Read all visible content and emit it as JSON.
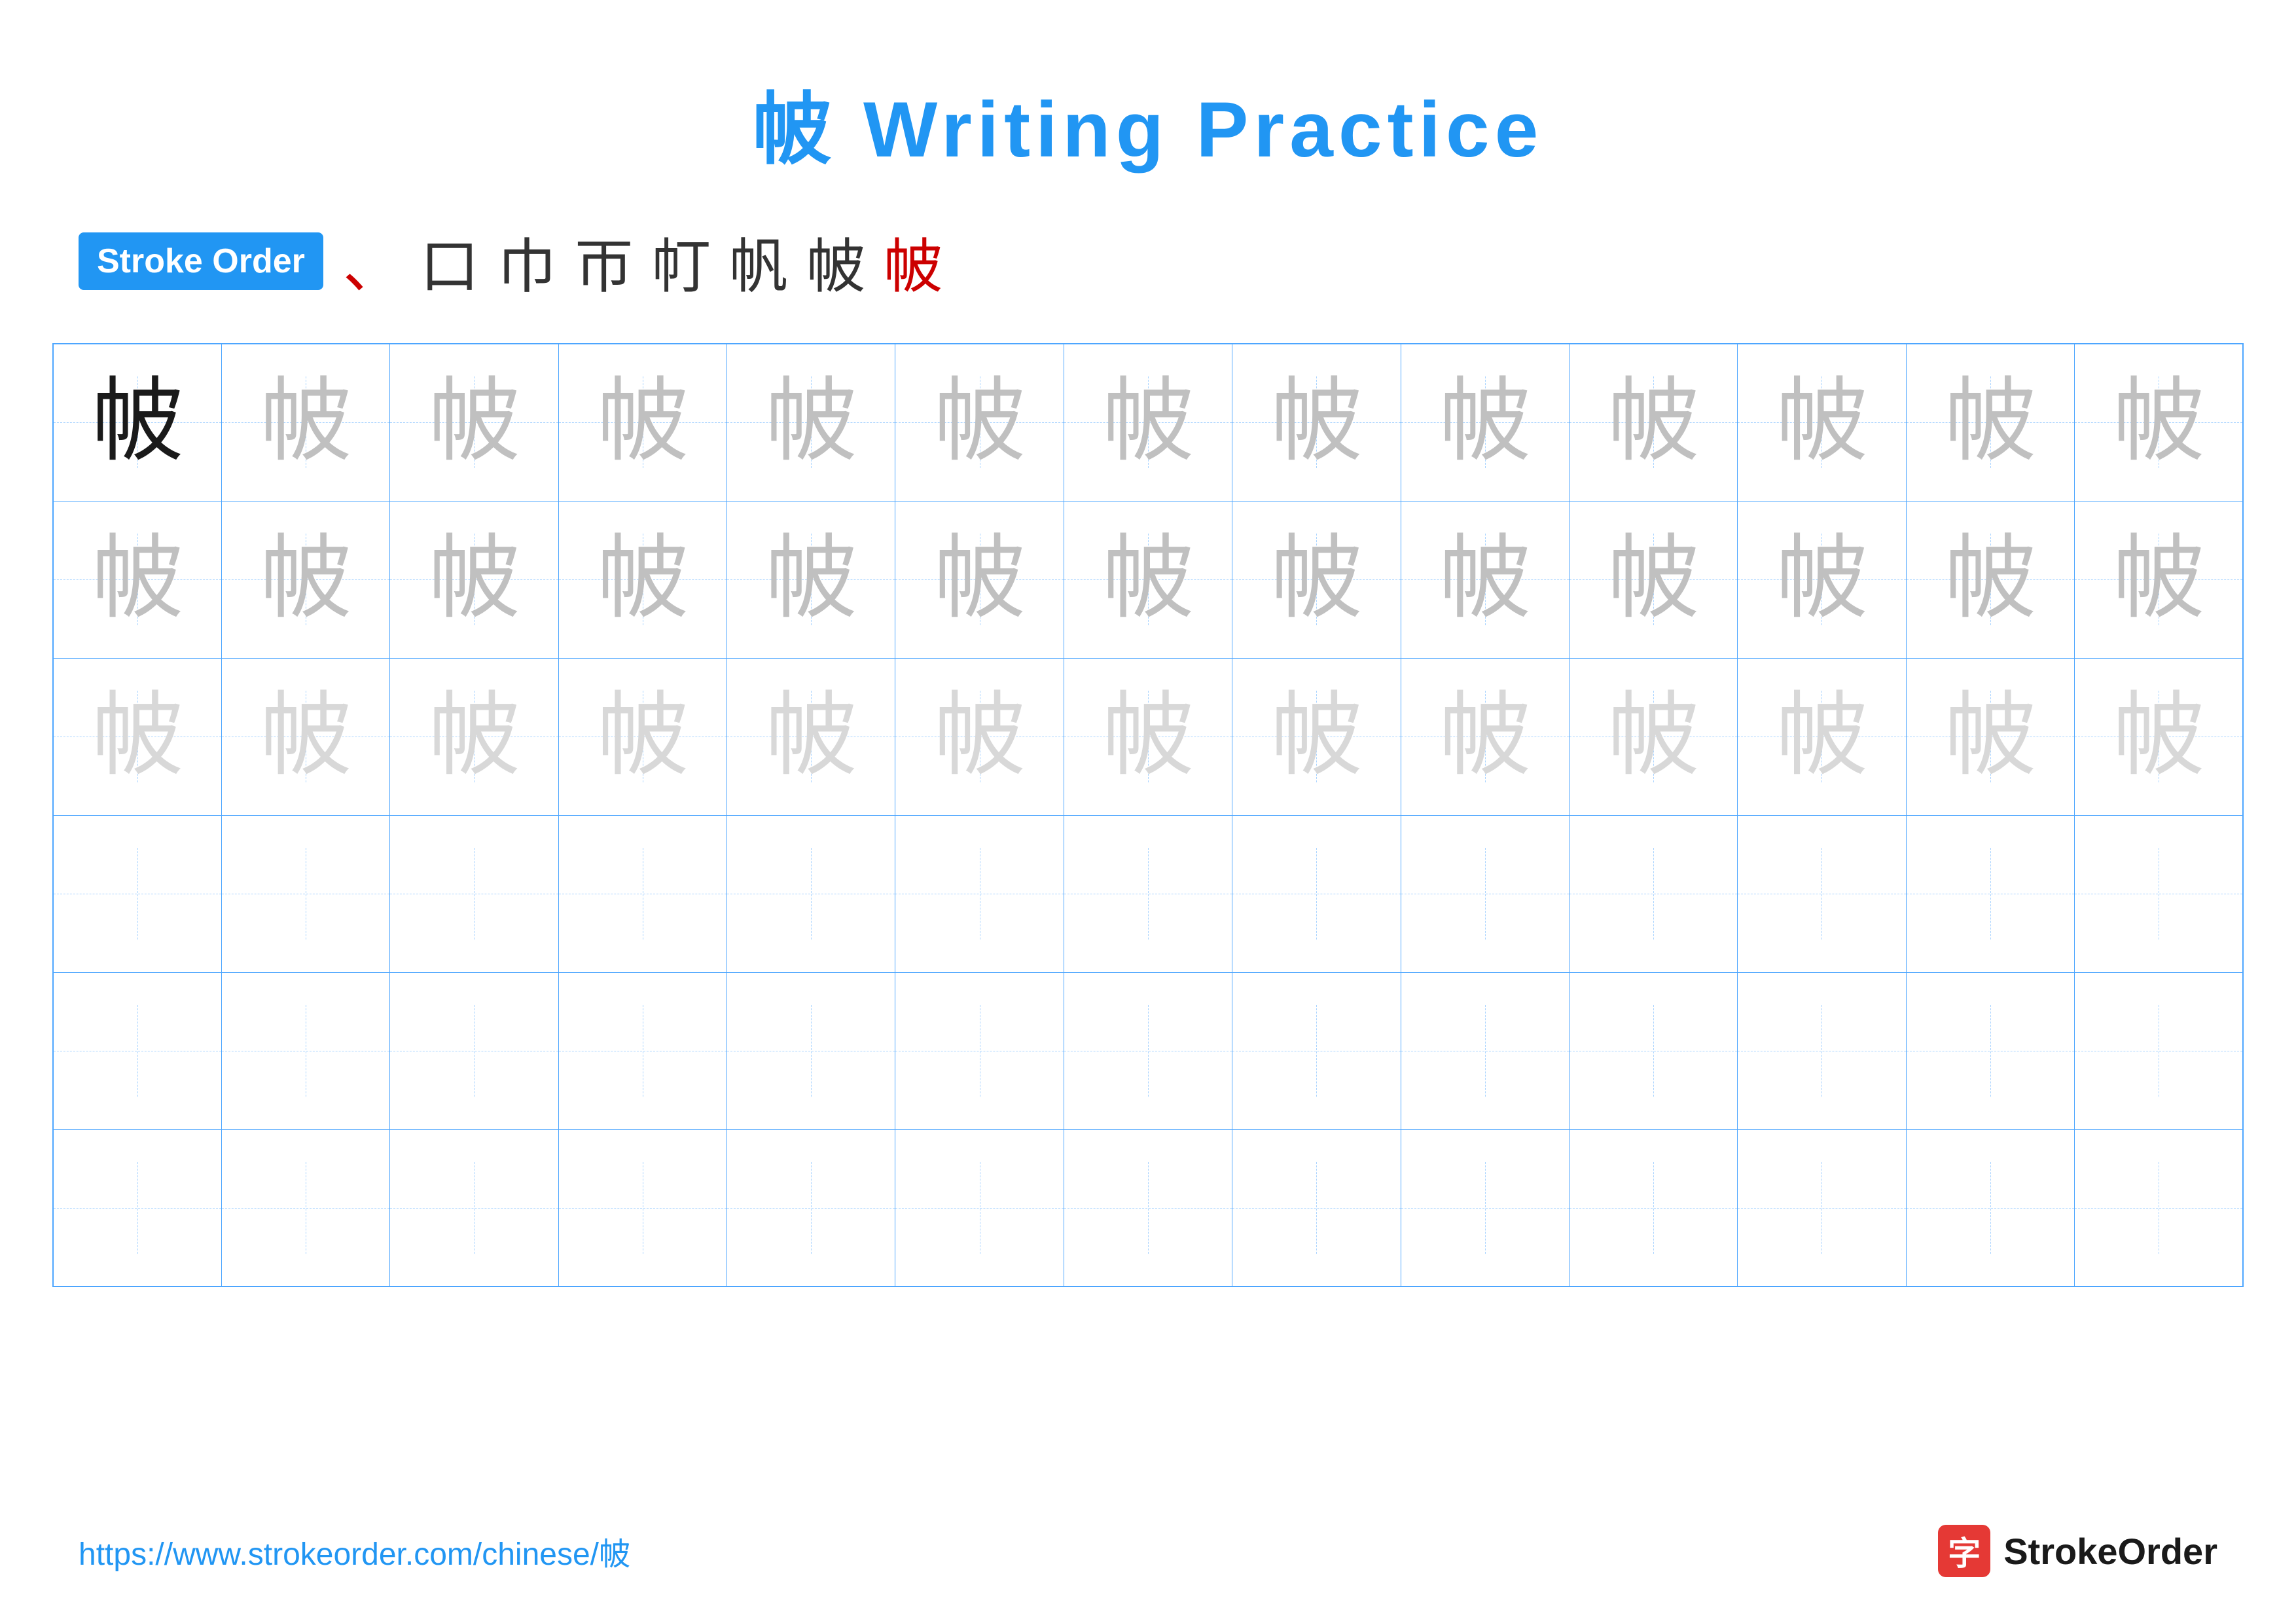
{
  "title": "帔 Writing Practice",
  "character": "帔",
  "stroke_order_badge": "Stroke Order",
  "stroke_sequence": [
    "、",
    "口",
    "巾",
    "帀",
    "帄",
    "帆",
    "帔",
    "帔"
  ],
  "grid": {
    "rows": 6,
    "cols": 13,
    "cells": [
      [
        "dark",
        "medium",
        "medium",
        "medium",
        "medium",
        "medium",
        "medium",
        "medium",
        "medium",
        "medium",
        "medium",
        "medium",
        "medium"
      ],
      [
        "medium",
        "medium",
        "medium",
        "medium",
        "medium",
        "medium",
        "medium",
        "medium",
        "medium",
        "medium",
        "medium",
        "medium",
        "medium"
      ],
      [
        "light",
        "light",
        "light",
        "light",
        "light",
        "light",
        "light",
        "light",
        "light",
        "light",
        "light",
        "light",
        "light"
      ],
      [
        "empty",
        "empty",
        "empty",
        "empty",
        "empty",
        "empty",
        "empty",
        "empty",
        "empty",
        "empty",
        "empty",
        "empty",
        "empty"
      ],
      [
        "empty",
        "empty",
        "empty",
        "empty",
        "empty",
        "empty",
        "empty",
        "empty",
        "empty",
        "empty",
        "empty",
        "empty",
        "empty"
      ],
      [
        "empty",
        "empty",
        "empty",
        "empty",
        "empty",
        "empty",
        "empty",
        "empty",
        "empty",
        "empty",
        "empty",
        "empty",
        "empty"
      ]
    ]
  },
  "footer": {
    "url": "https://www.strokeorder.com/chinese/帔",
    "logo_char": "字",
    "logo_text": "StrokeOrder"
  }
}
